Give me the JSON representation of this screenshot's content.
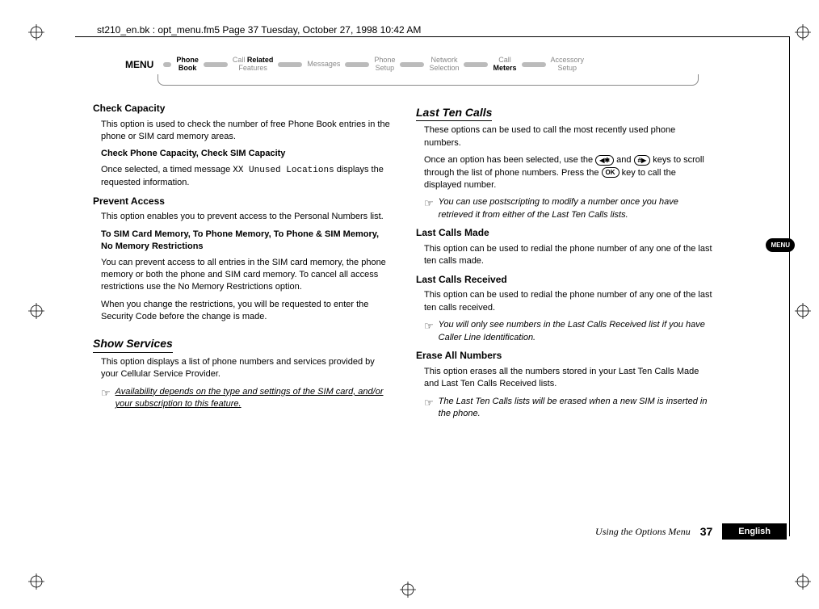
{
  "meta": {
    "header": "st210_en.bk : opt_menu.fm5  Page 37  Tuesday, October 27, 1998  10:42 AM"
  },
  "menu": {
    "label": "MENU",
    "items": [
      {
        "line1": "Phone",
        "line2": "Book",
        "style": "active"
      },
      {
        "line1_pre": "Call ",
        "line1_bold": "Related",
        "line2": "Features",
        "style": "mixed"
      },
      {
        "line1": "Messages",
        "line2": "",
        "style": "dim"
      },
      {
        "line1": "Phone",
        "line2": "Setup",
        "style": "dim"
      },
      {
        "line1": "Network",
        "line2": "Selection",
        "style": "dim"
      },
      {
        "line1_pre": "Call",
        "line2_bold": "Meters",
        "style": "mixed2"
      },
      {
        "line1": "Accessory",
        "line2": "Setup",
        "style": "dim"
      }
    ]
  },
  "left": {
    "h1": "Check Capacity",
    "p1": "This option is used to check the number of free Phone Book entries in the phone or SIM card memory areas.",
    "sh1": "Check Phone Capacity, Check SIM Capacity",
    "p2a": "Once selected, a timed message ",
    "p2b": "XX Unused Locations",
    "p2c": " displays the requested information.",
    "h2": "Prevent Access",
    "p3": "This option enables you to prevent access to the Personal Numbers list.",
    "sh2": "To SIM Card Memory, To Phone Memory, To Phone & SIM Memory, No Memory Restrictions",
    "p4": "You can prevent access to all entries in the SIM card memory, the phone memory or both the phone and SIM card memory. To cancel all access restrictions use the No Memory Restrictions option.",
    "p5": "When you change the restrictions, you will be requested to enter the Security Code before the change is made.",
    "h3": "Show Services",
    "p6": "This option displays a list of phone numbers and services provided by your Cellular Service Provider.",
    "note1": "Availability depends on the type and settings of the SIM card, and/or your subscription to this feature."
  },
  "right": {
    "h1": "Last Ten Calls",
    "p1": "These options can be used to call the most recently used phone numbers.",
    "p2a": "Once an option has been selected, use the ",
    "key1": "◀✱",
    "p2b": " and ",
    "key2": "#▶",
    "p2c": " keys to scroll through the list of phone numbers. Press the ",
    "key3": "OK",
    "p2d": " key to call the displayed number.",
    "note1": "You can use postscripting to modify a number once you have retrieved it from either of the Last Ten Calls lists.",
    "h2": "Last Calls Made",
    "p3": "This option can be used to redial the phone number of any one of the last ten calls made.",
    "h3": "Last Calls Received",
    "p4": "This option can be used to redial the phone number of any one of the last ten calls received.",
    "note2": "You will only see numbers in the Last Calls Received list if you have Caller Line Identification.",
    "h4": "Erase All Numbers",
    "p5": "This option erases all the numbers stored in your Last Ten Calls Made and Last Ten Calls Received lists.",
    "note3": "The Last Ten Calls lists will be erased when a new SIM is inserted in the phone."
  },
  "footer": {
    "title": "Using the Options Menu",
    "page": "37",
    "lang": "English"
  },
  "sidetab": "MENU"
}
